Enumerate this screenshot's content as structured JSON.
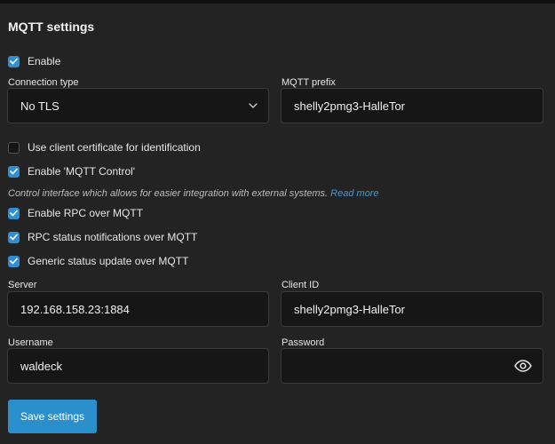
{
  "section": {
    "title": "MQTT settings"
  },
  "enable": {
    "label": "Enable",
    "checked": true
  },
  "connection_type": {
    "label": "Connection type",
    "value": "No TLS"
  },
  "mqtt_prefix": {
    "label": "MQTT prefix",
    "value": "shelly2pmg3-HalleTor"
  },
  "client_cert": {
    "label": "Use client certificate for identification",
    "checked": false
  },
  "mqtt_control": {
    "label": "Enable 'MQTT Control'",
    "checked": true
  },
  "control_desc": {
    "text": "Control interface which allows for easier integration with external systems.",
    "link": "Read more"
  },
  "rpc": {
    "label": "Enable RPC over MQTT",
    "checked": true
  },
  "rpc_status": {
    "label": "RPC status notifications over MQTT",
    "checked": true
  },
  "generic_status": {
    "label": "Generic status update over MQTT",
    "checked": true
  },
  "server": {
    "label": "Server",
    "value": "192.168.158.23:1884"
  },
  "client_id": {
    "label": "Client ID",
    "value": "shelly2pmg3-HalleTor"
  },
  "username": {
    "label": "Username",
    "value": "waldeck"
  },
  "password": {
    "label": "Password",
    "value": ""
  },
  "save_button": {
    "label": "Save settings"
  },
  "colors": {
    "accent": "#2f8fd3",
    "panel": "#232323",
    "field": "#161616",
    "link": "#3a9be0"
  }
}
